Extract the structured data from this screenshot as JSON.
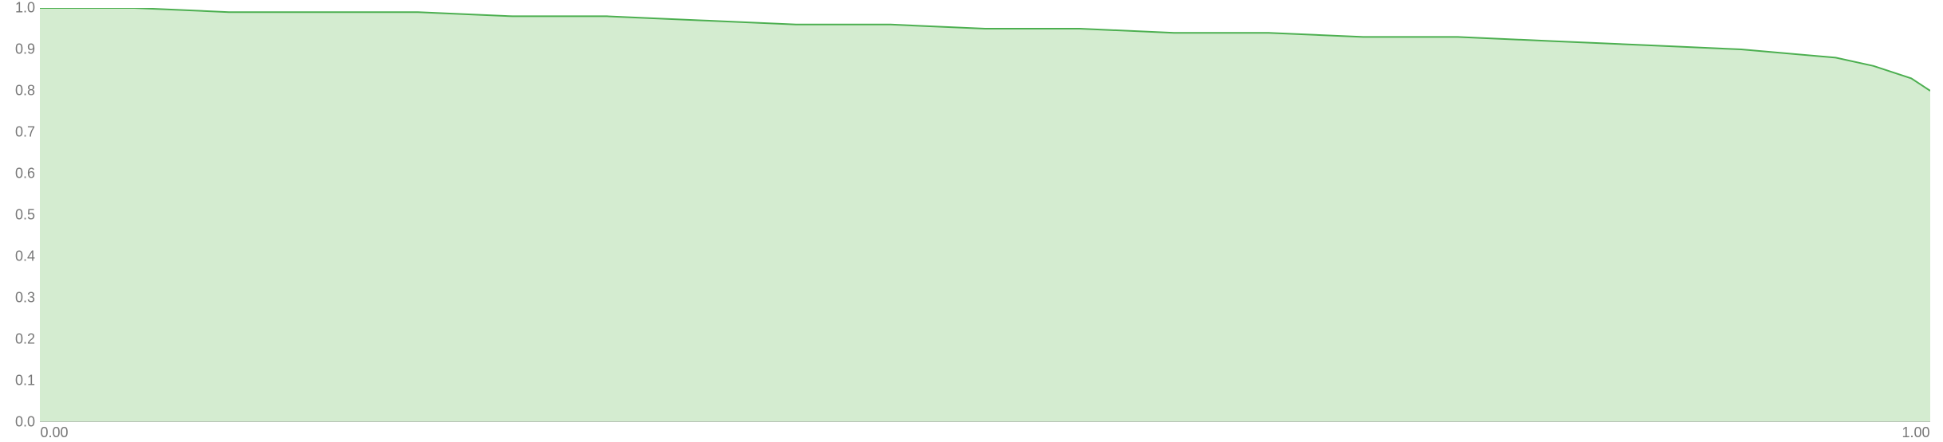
{
  "chart_data": {
    "type": "area",
    "x": [
      0.0,
      0.05,
      0.1,
      0.15,
      0.2,
      0.25,
      0.3,
      0.35,
      0.4,
      0.45,
      0.5,
      0.55,
      0.6,
      0.65,
      0.7,
      0.75,
      0.8,
      0.85,
      0.9,
      0.95,
      0.97,
      0.99,
      1.0
    ],
    "y": [
      1.0,
      1.0,
      0.99,
      0.99,
      0.99,
      0.98,
      0.98,
      0.97,
      0.96,
      0.96,
      0.95,
      0.95,
      0.94,
      0.94,
      0.93,
      0.93,
      0.92,
      0.91,
      0.9,
      0.88,
      0.86,
      0.83,
      0.8
    ],
    "xlim": [
      0.0,
      1.0
    ],
    "ylim": [
      0.0,
      1.0
    ],
    "y_ticks": [
      0.0,
      0.1,
      0.2,
      0.3,
      0.4,
      0.5,
      0.6,
      0.7,
      0.8,
      0.9,
      1.0
    ],
    "x_ticks": [
      0.0,
      1.0
    ],
    "title": "",
    "xlabel": "",
    "ylabel": "",
    "fill_color": "#d4ecd0",
    "line_color": "#4caf50"
  },
  "y_tick_labels": [
    "0.0",
    "0.1",
    "0.2",
    "0.3",
    "0.4",
    "0.5",
    "0.6",
    "0.7",
    "0.8",
    "0.9",
    "1.0"
  ],
  "x_tick_labels": [
    "0.00",
    "1.00"
  ]
}
